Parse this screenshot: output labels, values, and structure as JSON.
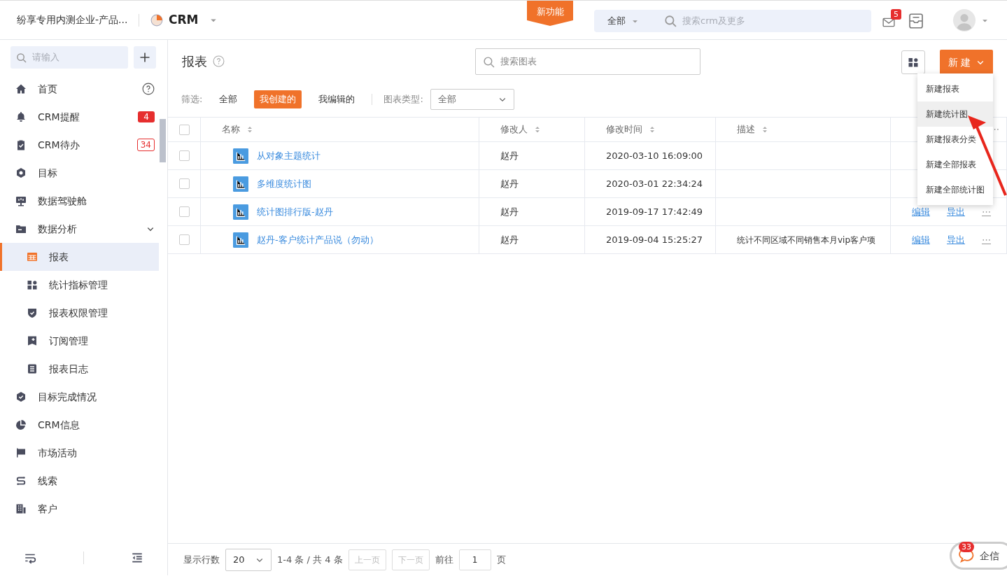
{
  "topbar": {
    "company": "纷享专用内测企业-产品...",
    "app": "CRM",
    "new_feature": "新功能",
    "scope": "全部",
    "search_placeholder": "搜索crm及更多",
    "mail_badge": "5"
  },
  "sidebar": {
    "search_placeholder": "请输入",
    "items": [
      {
        "label": "首页",
        "help": true,
        "selected": false
      },
      {
        "label": "CRM提醒",
        "badge": "4",
        "selected": false
      },
      {
        "label": "CRM待办",
        "badge": "34",
        "selected": false
      },
      {
        "label": "目标",
        "selected": false
      },
      {
        "label": "数据驾驶舱",
        "selected": false
      },
      {
        "label": "数据分析",
        "expanded": true,
        "selected": false,
        "children": [
          {
            "label": "报表",
            "selected": true
          },
          {
            "label": "统计指标管理",
            "selected": false
          },
          {
            "label": "报表权限管理",
            "selected": false
          },
          {
            "label": "订阅管理",
            "selected": false
          },
          {
            "label": "报表日志",
            "selected": false
          }
        ]
      },
      {
        "label": "目标完成情况",
        "selected": false
      },
      {
        "label": "CRM信息",
        "selected": false
      },
      {
        "label": "市场活动",
        "selected": false
      },
      {
        "label": "线索",
        "selected": false
      },
      {
        "label": "客户",
        "selected": false
      }
    ]
  },
  "page": {
    "title": "报表",
    "search_placeholder": "搜索图表",
    "new_button": "新 建"
  },
  "filters": {
    "label": "筛选:",
    "options": [
      {
        "label": "全部",
        "selected": false
      },
      {
        "label": "我创建的",
        "selected": true
      },
      {
        "label": "我编辑的",
        "selected": false
      }
    ],
    "type_label": "图表类型:",
    "type_value": "全部"
  },
  "table": {
    "select_all_checked": false,
    "columns": [
      "名称",
      "修改人",
      "修改时间",
      "描述"
    ],
    "more": "⋯",
    "rows": [
      {
        "checked": false,
        "name": "从对象主题统计",
        "modifier": "赵丹",
        "time": "2020-03-10 16:09:00",
        "desc": "",
        "actions": []
      },
      {
        "checked": false,
        "name": "多维度统计图",
        "modifier": "赵丹",
        "time": "2020-03-01 22:34:24",
        "desc": "",
        "actions": []
      },
      {
        "checked": false,
        "name": "统计图排行版-赵丹",
        "modifier": "赵丹",
        "time": "2019-09-17 17:42:49",
        "desc": "",
        "actions": [
          "编辑",
          "导出",
          "⋯"
        ]
      },
      {
        "checked": false,
        "name": "赵丹-客户统计产品说（勿动）",
        "modifier": "赵丹",
        "time": "2019-09-04 15:25:27",
        "desc": "统计不同区域不同销售本月vip客户项",
        "actions": [
          "编辑",
          "导出",
          "⋯"
        ]
      }
    ]
  },
  "menu": {
    "items": [
      {
        "label": "新建报表",
        "selected": false
      },
      {
        "label": "新建统计图",
        "selected": true
      },
      {
        "label": "新建报表分类",
        "selected": false
      },
      {
        "label": "新建全部报表",
        "selected": false
      },
      {
        "label": "新建全部统计图",
        "selected": false
      }
    ]
  },
  "footer": {
    "rows_label": "显示行数",
    "page_size": "20",
    "range": "1-4 条 / 共 4 条",
    "prev": "上一页",
    "next": "下一页",
    "goto": "前往",
    "page": "1",
    "page_unit": "页"
  },
  "chat": {
    "label": "企信",
    "badge": "33"
  }
}
